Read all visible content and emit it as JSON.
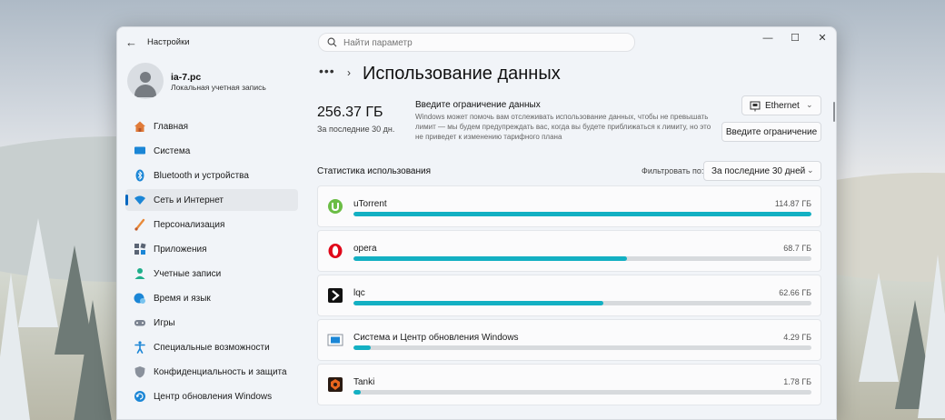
{
  "window": {
    "app_title": "Настройки",
    "search_placeholder": "Найти параметр"
  },
  "profile": {
    "name": "ia-7.pc",
    "subtitle": "Локальная учетная запись"
  },
  "nav": [
    {
      "label": "Главная",
      "icon": "home-icon",
      "active": false
    },
    {
      "label": "Система",
      "icon": "system-icon",
      "active": false
    },
    {
      "label": "Bluetooth и устройства",
      "icon": "bluetooth-icon",
      "active": false
    },
    {
      "label": "Сеть и Интернет",
      "icon": "network-icon",
      "active": true
    },
    {
      "label": "Персонализация",
      "icon": "brush-icon",
      "active": false
    },
    {
      "label": "Приложения",
      "icon": "apps-icon",
      "active": false
    },
    {
      "label": "Учетные записи",
      "icon": "accounts-icon",
      "active": false
    },
    {
      "label": "Время и язык",
      "icon": "globe-clock-icon",
      "active": false
    },
    {
      "label": "Игры",
      "icon": "gamepad-icon",
      "active": false
    },
    {
      "label": "Специальные возможности",
      "icon": "accessibility-icon",
      "active": false
    },
    {
      "label": "Конфиденциальность и защита",
      "icon": "shield-icon",
      "active": false
    },
    {
      "label": "Центр обновления Windows",
      "icon": "update-icon",
      "active": false
    }
  ],
  "main": {
    "breadcrumb_more": "•••",
    "title": "Использование данных",
    "total": "256.37 ГБ",
    "total_period": "За последние 30 дн.",
    "limit_title": "Введите ограничение данных",
    "limit_desc": "Windows может помочь вам отслеживать использование данных, чтобы не превышать лимит — мы будем предупреждать вас, когда вы будете приближаться к лимиту, но это не приведет к изменению тарифного плана",
    "adapter_label": "Ethernet",
    "limit_button": "Введите ограничение",
    "stats_title": "Статистика использования",
    "filter_label": "Фильтровать по:",
    "filter_value": "За последние 30 дней"
  },
  "apps": [
    {
      "name": "uTorrent",
      "usage": "114.87 ГБ",
      "fraction": 1.0,
      "icon": "utorrent-icon"
    },
    {
      "name": "opera",
      "usage": "68.7 ГБ",
      "fraction": 0.598,
      "icon": "opera-icon"
    },
    {
      "name": "lqc",
      "usage": "62.66 ГБ",
      "fraction": 0.546,
      "icon": "lqc-icon"
    },
    {
      "name": "Система и Центр обновления Windows",
      "usage": "4.29 ГБ",
      "fraction": 0.037,
      "icon": "windows-update-icon"
    },
    {
      "name": "Tanki",
      "usage": "1.78 ГБ",
      "fraction": 0.0155,
      "icon": "tanki-icon"
    }
  ],
  "colors": {
    "accent": "#0067c0",
    "usage_bar": "#13b0c3",
    "bar_track": "#d7dadd"
  }
}
